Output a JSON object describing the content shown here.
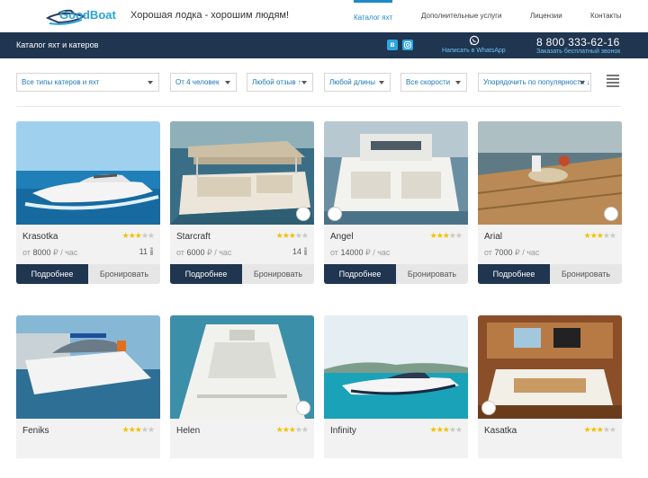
{
  "header": {
    "logo_text": "GoodBoat",
    "slogan": "Хорошая лодка - хорошим людям!",
    "nav": [
      {
        "label": "Каталог яхт",
        "active": true
      },
      {
        "label": "Дополнительные услуги",
        "active": false
      },
      {
        "label": "Лицензии",
        "active": false
      },
      {
        "label": "Контакты",
        "active": false
      }
    ]
  },
  "bar": {
    "title": "Каталог яхт и катеров",
    "vk_label": "в",
    "whatsapp_label": "Написать в WhatsApp",
    "phone": "8 800 333-62-16",
    "callback_label": "Заказать бесплатный звонок"
  },
  "filters": {
    "type": "Все типы катеров и яхт",
    "capacity": "От 4 человек",
    "rating": "Любой отзыв ↑",
    "length": "Любой длины",
    "speed": "Все скорости",
    "sort": "Упорядочить по популярности ↓"
  },
  "cards": {
    "more_label": "Подробнее",
    "book_label": "Бронировать",
    "items": [
      {
        "name": "Krasotka",
        "rating": 3,
        "price_prefix": "от",
        "price": "8000",
        "price_unit": "₽ / час",
        "capacity": "11"
      },
      {
        "name": "Starcraft",
        "rating": 3,
        "price_prefix": "от",
        "price": "6000",
        "price_unit": "₽ / час",
        "capacity": "14"
      },
      {
        "name": "Angel",
        "rating": 3,
        "price_prefix": "от",
        "price": "14000",
        "price_unit": "₽ / час",
        "capacity": ""
      },
      {
        "name": "Arial",
        "rating": 3,
        "price_prefix": "от",
        "price": "7000",
        "price_unit": "₽ / час",
        "capacity": ""
      },
      {
        "name": "Feniks",
        "rating": 3
      },
      {
        "name": "Helen",
        "rating": 3
      },
      {
        "name": "Infinity",
        "rating": 3
      },
      {
        "name": "Kasatka",
        "rating": 3
      }
    ]
  },
  "colors": {
    "brand_blue": "#29a3d9",
    "header_bar": "#1f3550",
    "star": "#f2c200"
  }
}
